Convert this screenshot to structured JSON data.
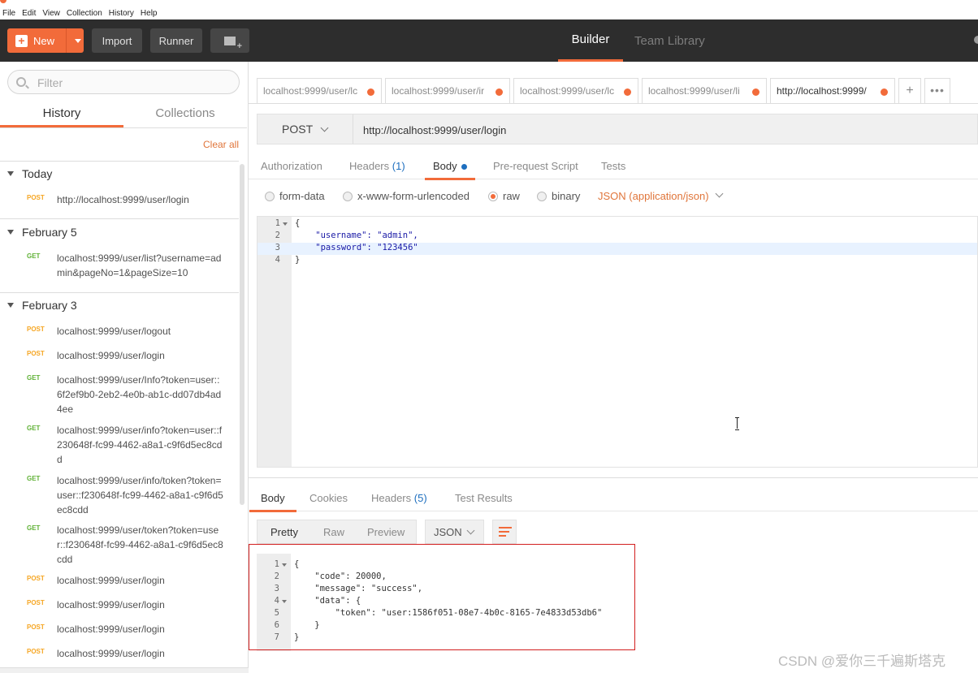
{
  "menubar": {
    "items": [
      "File",
      "Edit",
      "View",
      "Collection",
      "History",
      "Help"
    ]
  },
  "toolbar": {
    "new_label": "New",
    "import_label": "Import",
    "runner_label": "Runner",
    "builder_label": "Builder",
    "team_library_label": "Team Library"
  },
  "sidebar": {
    "filter_placeholder": "Filter",
    "tabs": [
      "History",
      "Collections"
    ],
    "clear_all": "Clear all",
    "groups": [
      {
        "title": "Today",
        "items": [
          {
            "method": "POST",
            "url": "http://localhost:9999/user/login"
          }
        ]
      },
      {
        "title": "February 5",
        "items": [
          {
            "method": "GET",
            "url": "localhost:9999/user/list?username=admin&pageNo=1&pageSize=10"
          }
        ]
      },
      {
        "title": "February 3",
        "items": [
          {
            "method": "POST",
            "url": "localhost:9999/user/logout"
          },
          {
            "method": "POST",
            "url": "localhost:9999/user/login"
          },
          {
            "method": "GET",
            "url": "localhost:9999/user/Info?token=user::6f2ef9b0-2eb2-4e0b-ab1c-dd07db4ad4ee"
          },
          {
            "method": "GET",
            "url": "localhost:9999/user/info?token=user::f230648f-fc99-4462-a8a1-c9f6d5ec8cdd"
          },
          {
            "method": "GET",
            "url": "localhost:9999/user/info/token?token=user::f230648f-fc99-4462-a8a1-c9f6d5ec8cdd"
          },
          {
            "method": "GET",
            "url": "localhost:9999/user/token?token=user::f230648f-fc99-4462-a8a1-c9f6d5ec8cdd"
          },
          {
            "method": "POST",
            "url": "localhost:9999/user/login"
          },
          {
            "method": "POST",
            "url": "localhost:9999/user/login"
          },
          {
            "method": "POST",
            "url": "localhost:9999/user/login"
          },
          {
            "method": "POST",
            "url": "localhost:9999/user/login"
          }
        ]
      }
    ]
  },
  "request_tabs": [
    "localhost:9999/user/lc",
    "localhost:9999/user/ir",
    "localhost:9999/user/lc",
    "localhost:9999/user/li",
    "http://localhost:9999/"
  ],
  "request": {
    "method": "POST",
    "url": "http://localhost:9999/user/login",
    "subtabs": {
      "authorization": "Authorization",
      "headers": "Headers",
      "headers_count": "(1)",
      "body": "Body",
      "prerequest": "Pre-request Script",
      "tests": "Tests"
    },
    "body_types": {
      "form_data": "form-data",
      "urlencoded": "x-www-form-urlencoded",
      "raw": "raw",
      "binary": "binary",
      "content_type": "JSON (application/json)"
    },
    "body_lines": [
      {
        "n": "1",
        "text": "{"
      },
      {
        "n": "2",
        "text": "    \"username\": \"admin\","
      },
      {
        "n": "3",
        "text": "    \"password\": \"123456\""
      },
      {
        "n": "4",
        "text": "}"
      }
    ]
  },
  "response": {
    "tabs": {
      "body": "Body",
      "cookies": "Cookies",
      "headers": "Headers",
      "headers_count": "(5)",
      "test_results": "Test Results"
    },
    "views": [
      "Pretty",
      "Raw",
      "Preview"
    ],
    "format": "JSON",
    "lines": [
      {
        "n": "1",
        "text": "{"
      },
      {
        "n": "2",
        "text": "    \"code\": 20000,"
      },
      {
        "n": "3",
        "text": "    \"message\": \"success\","
      },
      {
        "n": "4",
        "text": "    \"data\": {"
      },
      {
        "n": "5",
        "text": "        \"token\": \"user:1586f051-08e7-4b0c-8165-7e4833d53db6\""
      },
      {
        "n": "6",
        "text": "    }"
      },
      {
        "n": "7",
        "text": "}"
      }
    ]
  },
  "watermark": "CSDN @爱你三千遍斯塔克",
  "colors": {
    "accent": "#f26b3a",
    "post": "#f6a623",
    "get": "#5fb135",
    "toolbar_bg": "#2d2d2d",
    "highlight_box": "#d21f1f"
  }
}
